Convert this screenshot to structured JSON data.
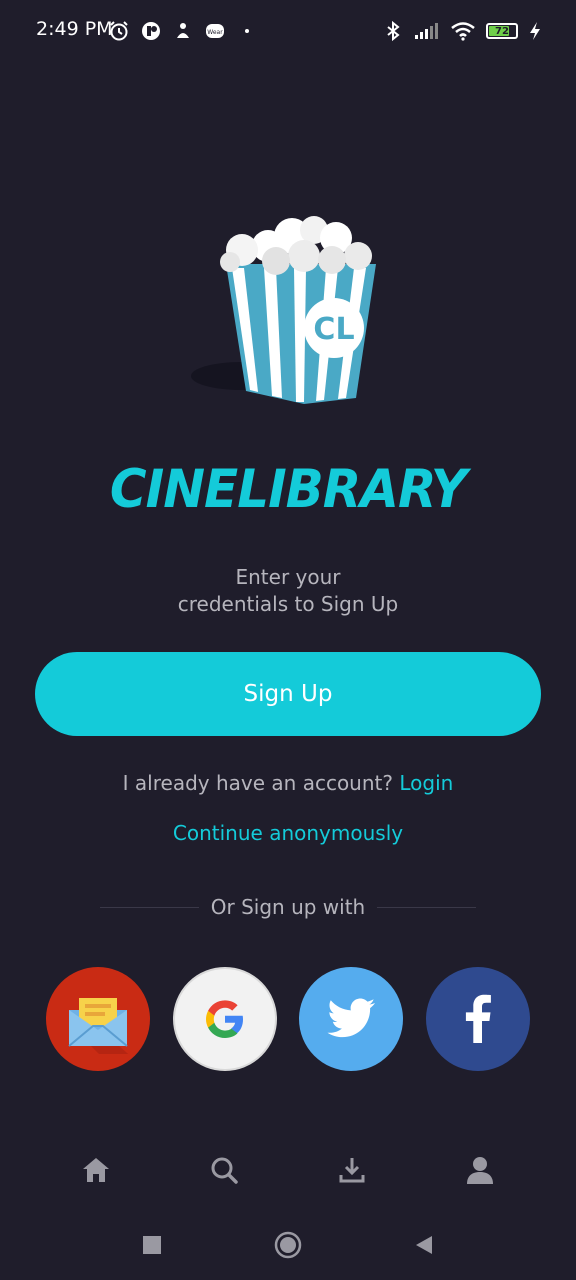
{
  "status_bar": {
    "time": "2:49 PM",
    "battery_level": "72",
    "left_icons": [
      "alarm-icon",
      "app-icon",
      "notification-icon",
      "wear-icon",
      "dot-icon"
    ],
    "right_icons": [
      "bluetooth-icon",
      "signal-icon",
      "wifi-icon",
      "battery-icon",
      "charging-icon"
    ]
  },
  "app": {
    "logo_text": "CL",
    "brand_name": "CINELIBRARY"
  },
  "auth": {
    "subtitle_line1": "Enter your",
    "subtitle_line2": "credentials to Sign Up",
    "signup_label": "Sign Up",
    "login_prompt": "I already have an account?",
    "login_link": "Login",
    "anonymous_link": "Continue anonymously",
    "divider_text": "Or Sign up with"
  },
  "social": [
    {
      "name": "email",
      "icon": "envelope-icon",
      "color": "#c92b14"
    },
    {
      "name": "google",
      "icon": "google-icon",
      "color": "#f2f2f2"
    },
    {
      "name": "twitter",
      "icon": "twitter-icon",
      "color": "#55acee"
    },
    {
      "name": "facebook",
      "icon": "facebook-icon",
      "color": "#2f4a8f"
    }
  ],
  "bottom_nav": [
    "home-icon",
    "search-icon",
    "download-icon",
    "profile-icon"
  ],
  "colors": {
    "background": "#1f1d2b",
    "accent": "#14cbd9",
    "muted_text": "#b6b5bd"
  }
}
